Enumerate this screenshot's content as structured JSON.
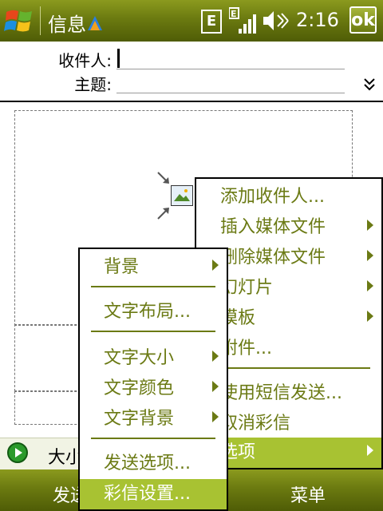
{
  "topbar": {
    "title": "信息",
    "network_badge": "E",
    "time": "2:16",
    "ok_label": "ok"
  },
  "header": {
    "to_label": "收件人:",
    "to_value": "",
    "subject_label": "主题:",
    "subject_value": ""
  },
  "status": {
    "size_label": "大小"
  },
  "softkeys": {
    "left": "发送",
    "right": "菜单"
  },
  "menu_main": {
    "items": [
      {
        "label": "添加收件人..."
      },
      {
        "label": "插入媒体文件"
      },
      {
        "label": "删除媒体文件"
      },
      {
        "label": "幻灯片"
      },
      {
        "label": "模板"
      },
      {
        "label": "附件..."
      },
      {
        "label": "使用短信发送..."
      },
      {
        "label": "取消彩信"
      },
      {
        "label": "选项"
      }
    ]
  },
  "menu_options": {
    "items": [
      {
        "label": "背景"
      },
      {
        "label": "文字布局..."
      },
      {
        "label": "文字大小"
      },
      {
        "label": "文字颜色"
      },
      {
        "label": "文字背景"
      },
      {
        "label": "发送选项..."
      },
      {
        "label": "彩信设置..."
      }
    ]
  },
  "colors": {
    "bar_dark": "#4f5c06",
    "bar_light": "#8b9a1e",
    "menu_text": "#6b7a14",
    "menu_selected": "#a8c232"
  }
}
